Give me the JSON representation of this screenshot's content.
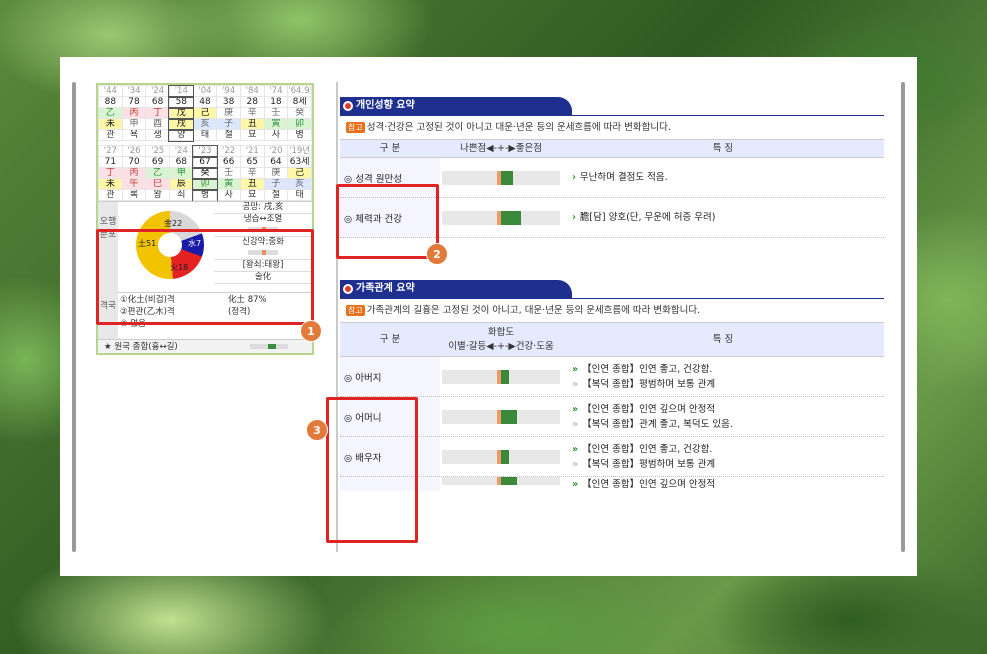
{
  "left": {
    "grid1": {
      "years": [
        "'44",
        "'34",
        "'24",
        "'14",
        "'04",
        "'94",
        "'84",
        "'74",
        "'64.9월"
      ],
      "ages": [
        "88",
        "78",
        "68",
        "58",
        "48",
        "38",
        "28",
        "18",
        "8세"
      ],
      "stems": [
        "乙",
        "丙",
        "丁",
        "戊",
        "己",
        "庚",
        "辛",
        "壬",
        "癸"
      ],
      "branches": [
        "未",
        "申",
        "酉",
        "戌",
        "亥",
        "子",
        "丑",
        "寅",
        "卯"
      ],
      "states": [
        "관",
        "욕",
        "생",
        "양",
        "태",
        "절",
        "묘",
        "사",
        "병"
      ]
    },
    "grid2": {
      "years": [
        "'27",
        "'26",
        "'25",
        "'24",
        "'23",
        "'22",
        "'21",
        "'20",
        "'19년"
      ],
      "ages": [
        "71",
        "70",
        "69",
        "68",
        "67",
        "66",
        "65",
        "64",
        "63세"
      ],
      "stems": [
        "丁",
        "丙",
        "乙",
        "甲",
        "癸",
        "壬",
        "辛",
        "庚",
        "己"
      ],
      "branches": [
        "未",
        "午",
        "巳",
        "辰",
        "卯",
        "寅",
        "丑",
        "子",
        "亥"
      ],
      "states": [
        "관",
        "록",
        "왕",
        "쇠",
        "병",
        "사",
        "묘",
        "절",
        "태"
      ]
    },
    "ohang": {
      "side_label": "오행 분포",
      "pie_labels": {
        "metal": "金22",
        "water": "水7",
        "fire": "火18",
        "earth": "土51"
      },
      "info": [
        "공망: 戌,亥",
        "냉습↔조열",
        "신강약:중화",
        "[왕쇠:태왕]",
        "술化"
      ]
    },
    "gyeok": {
      "side_label": "격국",
      "rows": [
        {
          "left": "①化土(비겁)격",
          "right": "化土 87%"
        },
        {
          "left": "②편관(乙木)격",
          "right": "(정격)"
        },
        {
          "left": "③ 없음",
          "right": ""
        }
      ]
    },
    "wonguk": "★ 원국 종합(흉↔길)"
  },
  "personality": {
    "title": "개인성향 요약",
    "note_badge": "참고",
    "note": "성격·건강은 고정된 것이 아니고 대운·년운 등의 운세흐름에 따라 변화합니다.",
    "headers": [
      "구 분",
      "나쁜점◀-+-▶좋은점",
      "특 징"
    ],
    "rows": [
      {
        "label": "◎ 성격 원만성",
        "desc": "무난하며 결점도 적음."
      },
      {
        "label": "◎ 체력과 건강",
        "desc": "膽[담] 양호(단, 무운에 허증 우려)"
      }
    ]
  },
  "family": {
    "title": "가족관계 요약",
    "note_badge": "참고",
    "note": "가족관계의 길흉은 고정된 것이 아니고, 대운·년운 등의 운세흐름에 따라 변화합니다.",
    "headers": [
      "구 분",
      "화합도",
      "이별·갈등◀-+-▶건강·도움",
      "특 징"
    ],
    "rows": [
      {
        "label": "◎ 아버지",
        "l1": "【인연 종합】인연 좋고, 건강함.",
        "l2": "【복덕 종합】평범하며 보통 관계"
      },
      {
        "label": "◎ 어머니",
        "l1": "【인연 종합】인연 깊으며 안정적",
        "l2": "【복덕 종합】관계 좋고, 복덕도 있음."
      },
      {
        "label": "◎ 배우자",
        "l1": "【인연 종합】인연 좋고, 건강함.",
        "l2": "【복덕 종합】평범하며 보통 관계"
      },
      {
        "label": "",
        "l1": "【인연 종합】인연 깊으며 안정적",
        "l2": ""
      }
    ]
  },
  "markers": [
    "1",
    "2",
    "3"
  ]
}
